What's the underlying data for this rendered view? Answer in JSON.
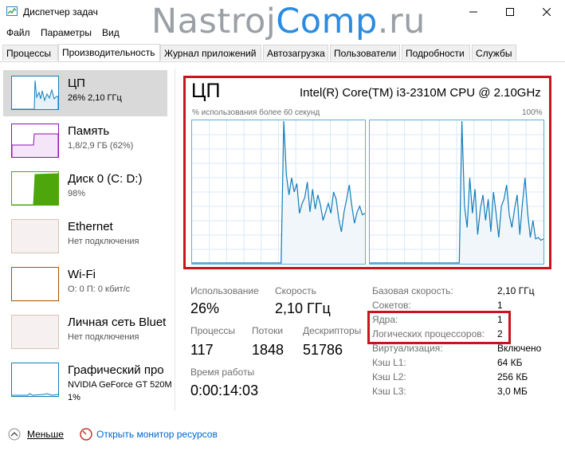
{
  "window": {
    "title": "Диспетчер задач"
  },
  "watermark": {
    "part1": "Nastroj",
    "part2": "Comp",
    "part3": ".ru"
  },
  "menu": [
    "Файл",
    "Параметры",
    "Вид"
  ],
  "tabs": [
    "Процессы",
    "Производительность",
    "Журнал приложений",
    "Автозагрузка",
    "Пользователи",
    "Подробности",
    "Службы"
  ],
  "sidebar": {
    "items": [
      {
        "name": "ЦП",
        "sub1": "26% 2,10 ГГц",
        "sub2": "",
        "color": "#117dbb"
      },
      {
        "name": "Память",
        "sub1": "1,8/2,9 ГБ (62%)",
        "sub2": "",
        "color": "#8b12ae"
      },
      {
        "name": "Диск 0 (C: D:)",
        "sub1": "98%",
        "sub2": "",
        "color": "#4da60c"
      },
      {
        "name": "Ethernet",
        "sub1": "Нет подключения",
        "sub2": "",
        "color": "#a74f01"
      },
      {
        "name": "Wi-Fi",
        "sub1": "О: 0 П: 0 кбит/с",
        "sub2": "",
        "color": "#a74f01"
      },
      {
        "name": "Личная сеть Bluet",
        "sub1": "Нет подключения",
        "sub2": "",
        "color": "#a74f01"
      },
      {
        "name": "Графический про",
        "sub1": "NVIDIA GeForce GT 520M",
        "sub2": "1%",
        "color": "#117dbb"
      }
    ]
  },
  "cpu": {
    "title": "ЦП",
    "model": "Intel(R) Core(TM) i3-2310M CPU @ 2.10GHz",
    "graph_label_left": "% использования более 60 секунд",
    "graph_label_right": "100%",
    "core_graphs": [
      [
        0,
        0,
        0,
        0,
        0,
        0,
        0,
        0,
        0,
        0,
        0,
        0,
        0,
        0,
        0,
        0,
        0,
        0,
        0,
        0,
        0,
        0,
        0,
        0,
        0,
        0,
        0,
        0,
        0,
        0,
        0,
        0,
        0,
        0,
        0,
        100,
        62,
        48,
        60,
        50,
        56,
        35,
        42,
        46,
        57,
        36,
        52,
        38,
        48,
        41,
        30,
        36,
        42,
        35,
        50,
        45,
        31,
        22,
        36,
        45,
        55,
        40,
        28,
        36,
        40,
        34,
        35
      ],
      [
        0,
        0,
        0,
        0,
        0,
        0,
        0,
        0,
        0,
        0,
        0,
        0,
        0,
        0,
        0,
        0,
        0,
        0,
        0,
        0,
        0,
        0,
        0,
        0,
        0,
        0,
        0,
        0,
        0,
        0,
        0,
        0,
        0,
        0,
        0,
        100,
        40,
        25,
        60,
        35,
        52,
        20,
        38,
        48,
        30,
        45,
        22,
        50,
        35,
        18,
        40,
        45,
        55,
        34,
        25,
        38,
        48,
        20,
        42,
        60,
        35,
        18,
        30,
        17,
        18,
        16,
        17
      ]
    ],
    "stats": {
      "usage_label": "Использование",
      "usage_value": "26%",
      "speed_label": "Скорость",
      "speed_value": "2,10 ГГц",
      "processes_label": "Процессы",
      "processes_value": "117",
      "threads_label": "Потоки",
      "threads_value": "1848",
      "handles_label": "Дескрипторы",
      "handles_value": "51786",
      "uptime_label": "Время работы",
      "uptime_value": "0:00:14:03"
    },
    "details": [
      {
        "label": "Базовая скорость:",
        "value": "2,10 ГГц"
      },
      {
        "label": "Сокетов:",
        "value": "1"
      },
      {
        "label": "Ядра:",
        "value": "1"
      },
      {
        "label": "Логических процессоров:",
        "value": "2"
      },
      {
        "label": "Виртуализация:",
        "value": "Включено"
      },
      {
        "label": "Кэш L1:",
        "value": "64 КБ"
      },
      {
        "label": "Кэш L2:",
        "value": "256 КБ"
      },
      {
        "label": "Кэш L3:",
        "value": "3,0 МБ"
      }
    ]
  },
  "footer": {
    "less": "Меньше",
    "monitor": "Открыть монитор ресурсов"
  }
}
